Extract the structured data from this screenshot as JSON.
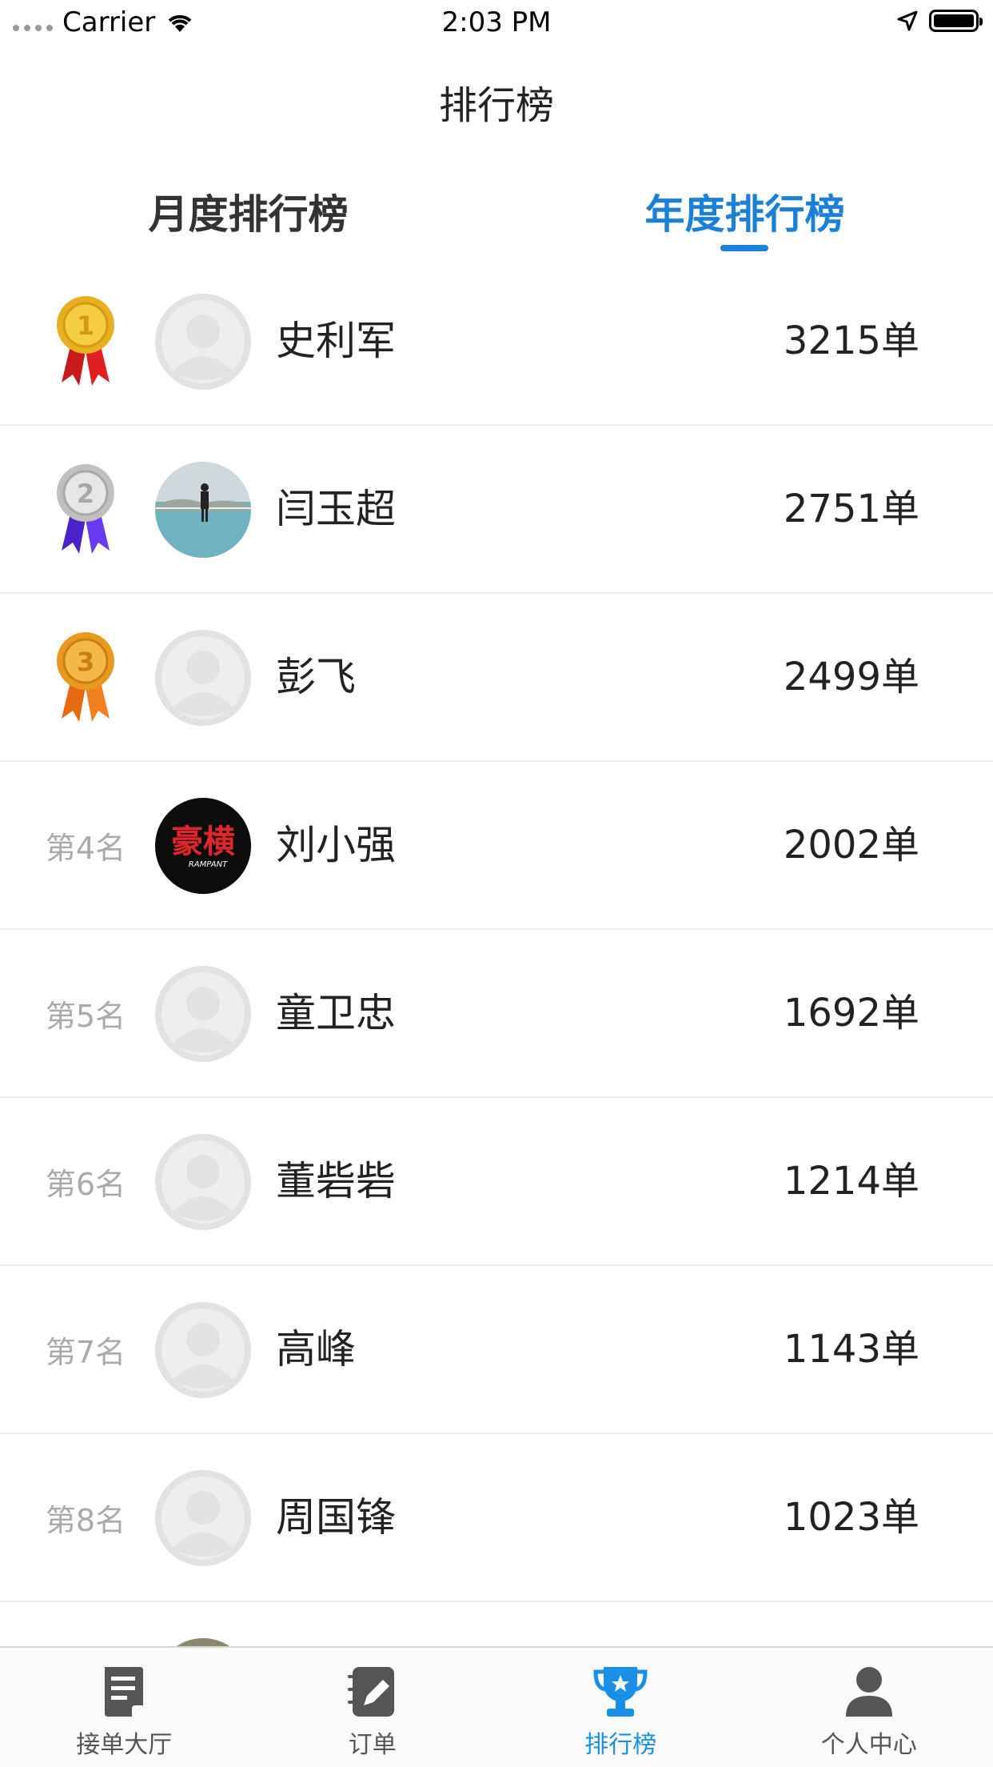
{
  "status_bar": {
    "carrier": "Carrier",
    "time": "2:03 PM"
  },
  "nav": {
    "title": "排行榜"
  },
  "tabs": {
    "monthly": "月度排行榜",
    "yearly": "年度排行榜",
    "active": "yearly"
  },
  "rankings": [
    {
      "rank_label": "",
      "medal": "gold",
      "name": "史利军",
      "orders": "3215单",
      "avatar": "default"
    },
    {
      "rank_label": "",
      "medal": "silver",
      "name": "闫玉超",
      "orders": "2751单",
      "avatar": "photo"
    },
    {
      "rank_label": "",
      "medal": "bronze",
      "name": "彭飞",
      "orders": "2499单",
      "avatar": "default"
    },
    {
      "rank_label": "第4名",
      "name": "刘小强",
      "orders": "2002单",
      "avatar": "logo"
    },
    {
      "rank_label": "第5名",
      "name": "童卫忠",
      "orders": "1692单",
      "avatar": "default"
    },
    {
      "rank_label": "第6名",
      "name": "董砦砦",
      "orders": "1214单",
      "avatar": "default"
    },
    {
      "rank_label": "第7名",
      "name": "高峰",
      "orders": "1143单",
      "avatar": "default"
    },
    {
      "rank_label": "第8名",
      "name": "周国锋",
      "orders": "1023单",
      "avatar": "default"
    }
  ],
  "avatar_logo_text": "豪横",
  "avatar_logo_sub": "RAMPANT",
  "tab_bar": [
    {
      "label": "接单大厅",
      "icon": "document-icon"
    },
    {
      "label": "订单",
      "icon": "edit-note-icon"
    },
    {
      "label": "排行榜",
      "icon": "trophy-icon",
      "active": true
    },
    {
      "label": "个人中心",
      "icon": "person-icon"
    }
  ],
  "colors": {
    "accent": "#1a80d8",
    "gold": "#e8b020",
    "silver": "#c8c8c8",
    "bronze": "#e89a20"
  }
}
